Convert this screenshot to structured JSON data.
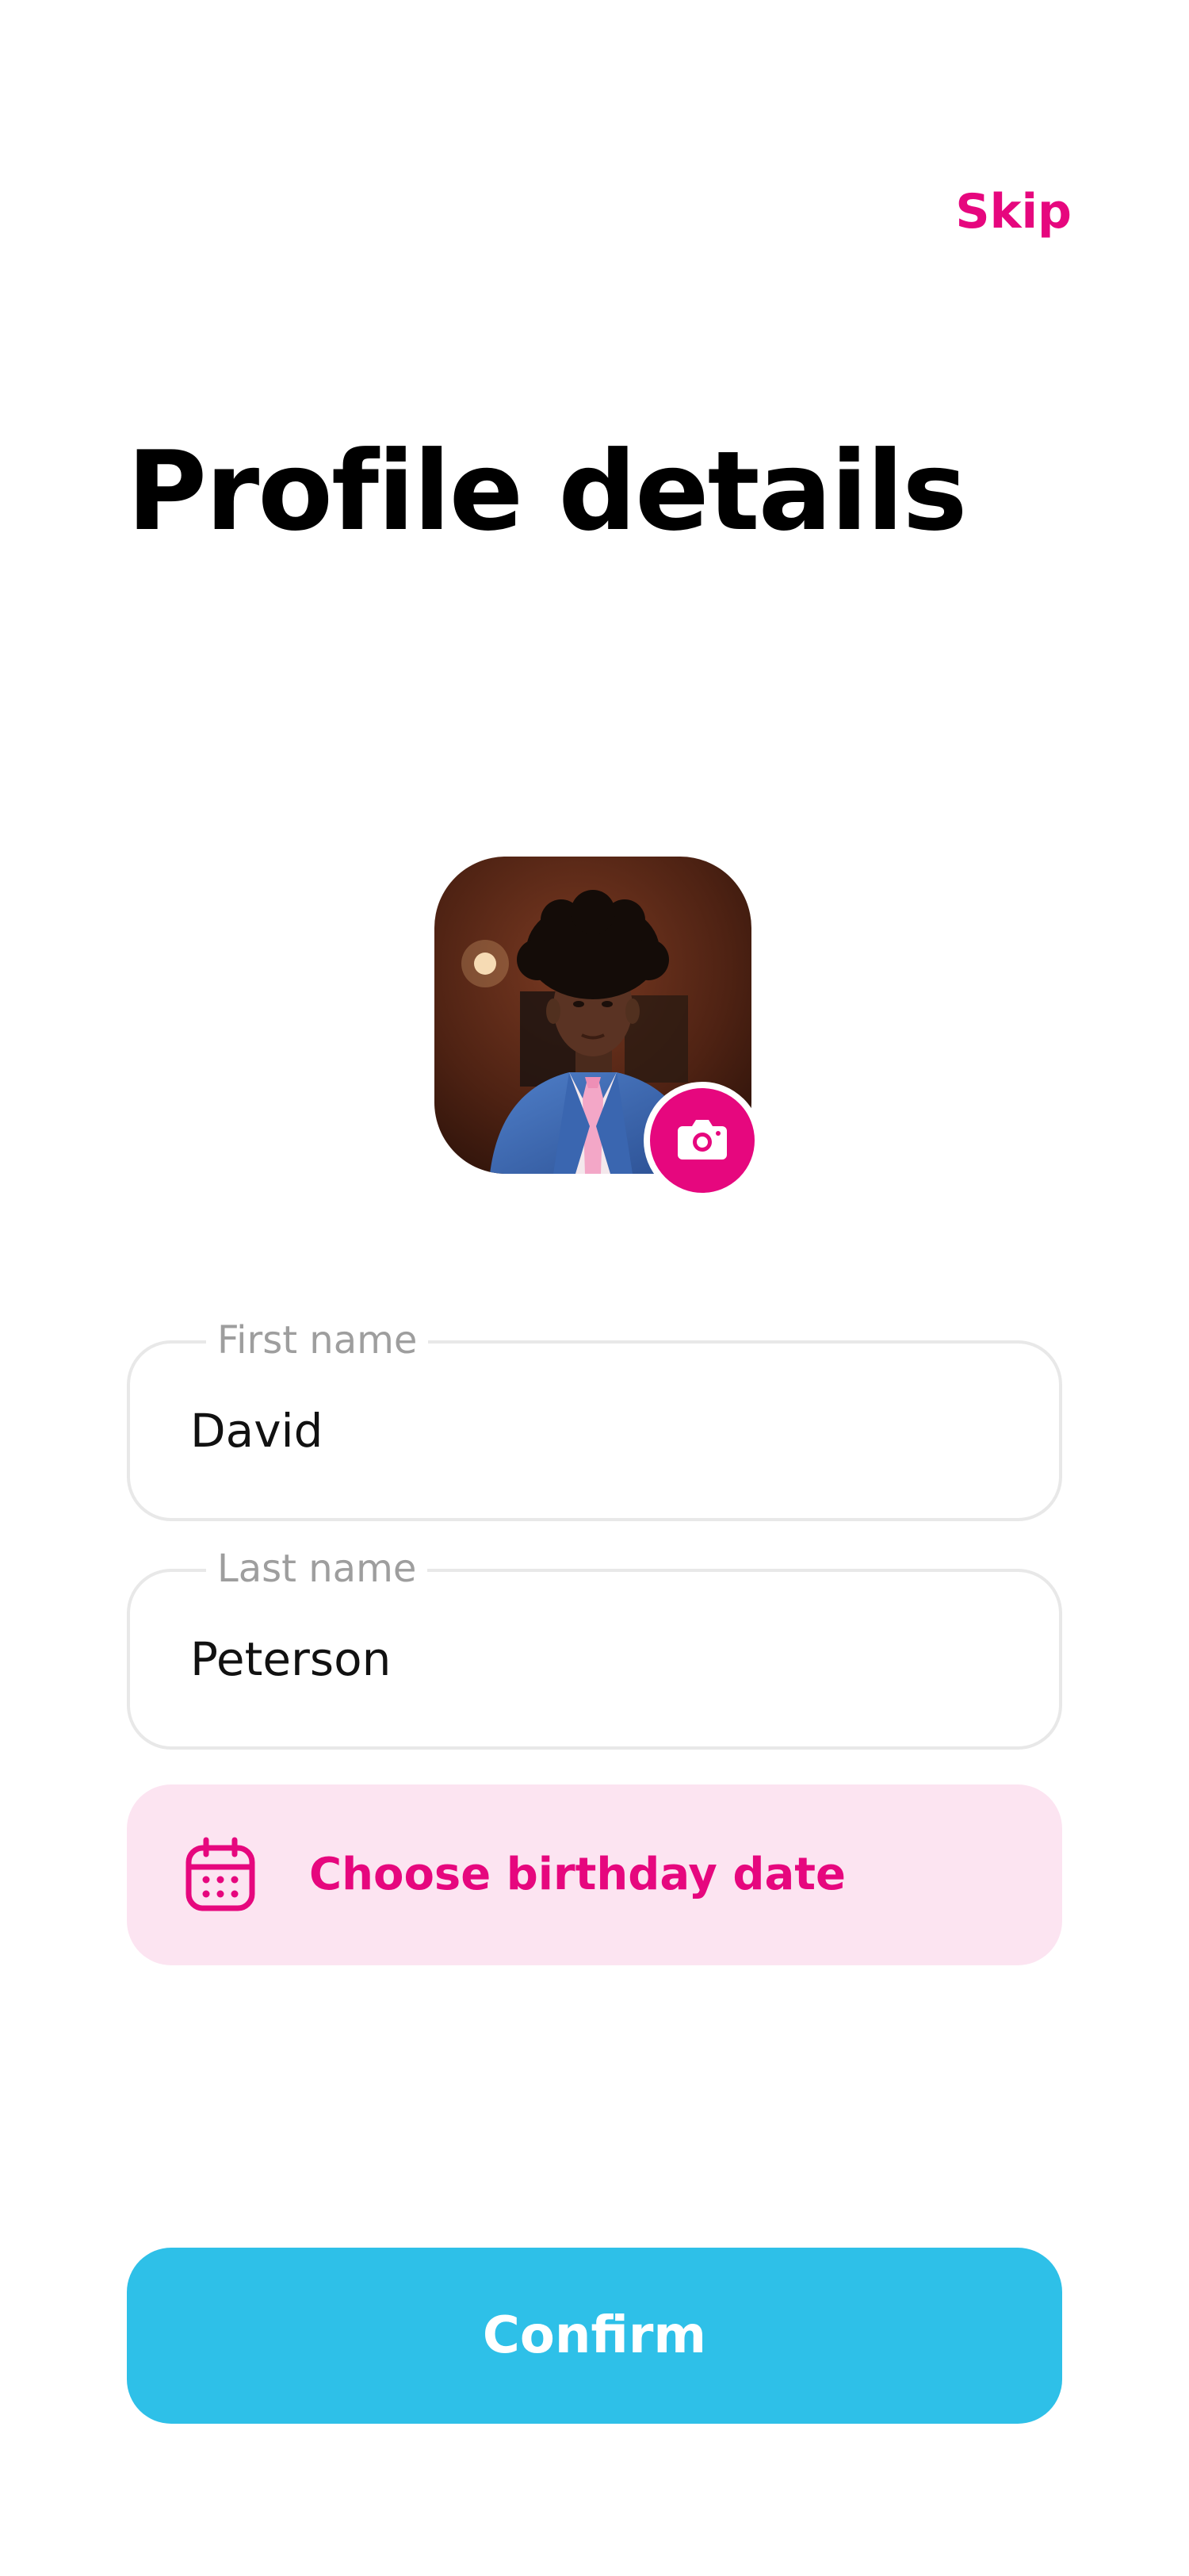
{
  "header": {
    "skip_label": "Skip"
  },
  "title": "Profile details",
  "avatar": {
    "icon": "camera-icon"
  },
  "form": {
    "first_name": {
      "label": "First name",
      "value": "David"
    },
    "last_name": {
      "label": "Last name",
      "value": "Peterson"
    },
    "birthday": {
      "label": "Choose birthday date",
      "icon": "calendar-icon"
    }
  },
  "confirm_label": "Confirm",
  "colors": {
    "accent": "#E6077E",
    "accent_soft": "#FCE4F1",
    "primary_button": "#2EC0E8",
    "field_border": "#E8E8E8",
    "label_gray": "#9E9E9E"
  }
}
